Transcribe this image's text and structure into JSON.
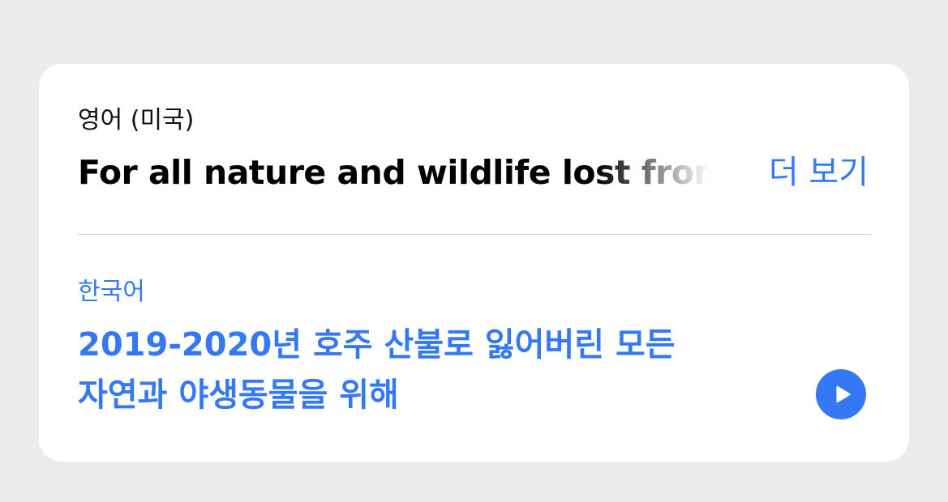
{
  "source": {
    "language": "영어 (미국)",
    "text": "For all nature and wildlife lost from",
    "more_label": "더 보기"
  },
  "target": {
    "language": "한국어",
    "lines": [
      "2019-2020년 호주 산불로 잃어버린 모든",
      "자연과 야생동물을 위해"
    ]
  },
  "icons": {
    "play": "play-icon"
  },
  "colors": {
    "accent": "#3478f6",
    "background": "#ececed",
    "card": "#ffffff",
    "text": "#000000",
    "divider": "#d2d2d6"
  }
}
